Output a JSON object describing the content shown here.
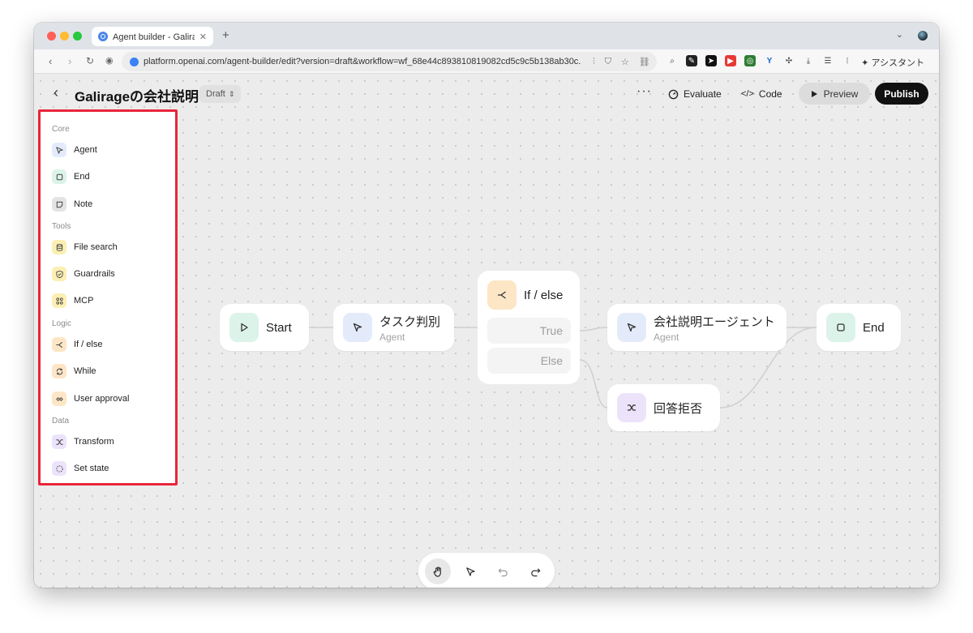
{
  "browser": {
    "tab_title": "Agent builder - Galirageの会",
    "url": "platform.openai.com/agent-builder/edit?version=draft&workflow=wf_68e44c893810819082cd5c9c5b138ab30c...",
    "assistant_label": "アシスタント"
  },
  "header": {
    "title": "Galirageの会社説明",
    "draft_label": "Draft",
    "evaluate_label": "Evaluate",
    "code_label": "Code",
    "preview_label": "Preview",
    "publish_label": "Publish"
  },
  "palette": {
    "sections": [
      {
        "label": "Core",
        "items": [
          {
            "label": "Agent",
            "icon": "agent-icon",
            "color": "#e3ebfb"
          },
          {
            "label": "End",
            "icon": "end-icon",
            "color": "#dcf3e9"
          },
          {
            "label": "Note",
            "icon": "note-icon",
            "color": "#e4e4e4"
          }
        ]
      },
      {
        "label": "Tools",
        "items": [
          {
            "label": "File search",
            "icon": "file-search-icon",
            "color": "#fbefb4"
          },
          {
            "label": "Guardrails",
            "icon": "guardrails-icon",
            "color": "#fbefb4"
          },
          {
            "label": "MCP",
            "icon": "mcp-icon",
            "color": "#fbefb4"
          }
        ]
      },
      {
        "label": "Logic",
        "items": [
          {
            "label": "If / else",
            "icon": "if-else-icon",
            "color": "#fde6c6"
          },
          {
            "label": "While",
            "icon": "while-icon",
            "color": "#fde6c6"
          },
          {
            "label": "User approval",
            "icon": "user-approval-icon",
            "color": "#fde6c6"
          }
        ]
      },
      {
        "label": "Data",
        "items": [
          {
            "label": "Transform",
            "icon": "transform-icon",
            "color": "#ece3fb"
          },
          {
            "label": "Set state",
            "icon": "set-state-icon",
            "color": "#ece3fb"
          }
        ]
      }
    ]
  },
  "canvas": {
    "start": {
      "title": "Start"
    },
    "task": {
      "title": "タスク判別",
      "subtitle": "Agent"
    },
    "ifelse": {
      "title": "If / else",
      "branches": [
        "True",
        "Else"
      ]
    },
    "company": {
      "title": "会社説明エージェント",
      "subtitle": "Agent"
    },
    "refuse": {
      "title": "回答拒否"
    },
    "end": {
      "title": "End"
    }
  },
  "colors": {
    "highlight_border": "#e8263a",
    "agent": "#e3ebfb",
    "end": "#dcf3e9",
    "tool": "#fbefb4",
    "logic": "#fde6c6",
    "data": "#ece3fb"
  }
}
